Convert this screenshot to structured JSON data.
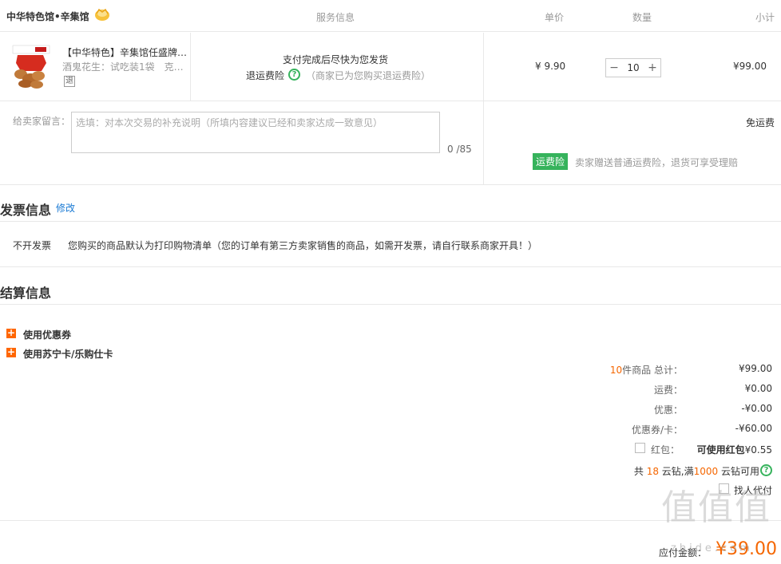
{
  "store": {
    "name": "中华特色馆•辛集馆"
  },
  "columns": {
    "service": "服务信息",
    "price": "单价",
    "quantity": "数量",
    "subtotal": "小计"
  },
  "item": {
    "title": "【中华特色】辛集馆任盛牌…",
    "spec": "酒鬼花生：试吃装1袋　克…",
    "return_tag": "退",
    "service_line1": "支付完成后尽快为您发货",
    "service_line2_label": "退运费险",
    "service_line2_note": "（商家已为您购买退运费险）",
    "price": "¥ 9.90",
    "qty": "10",
    "qty_minus": "−",
    "qty_plus": "+",
    "subtotal": "¥99.00"
  },
  "message": {
    "label": "给卖家留言：",
    "placeholder": "选填：对本次交易的补充说明（所填内容建议已经和卖家达成一致意见）",
    "count": "0 /85"
  },
  "shipping": {
    "free": "免运费",
    "insurance_tag": "运费险",
    "insurance_note": "卖家赠送普通运费险，退货可享受理赔"
  },
  "invoice": {
    "title": "发票信息",
    "edit": "修改",
    "type": "不开发票",
    "desc": "您购买的商品默认为打印购物清单（您的订单有第三方卖家销售的商品，如需开发票，请自行联系商家开具！）"
  },
  "settlement": {
    "title": "结算信息",
    "options": [
      "使用优惠券",
      "使用苏宁卡/乐购仕卡"
    ],
    "count_num": "10",
    "count_suffix": "件商品 总计：",
    "total": "¥99.00",
    "shipping_label": "运费：",
    "shipping_val": "¥0.00",
    "discount_label": "优惠：",
    "discount_val": "-¥0.00",
    "coupon_label": "优惠券/卡：",
    "coupon_val": "-¥60.00",
    "redpack_label": "红包：",
    "redpack_val_bold": "可使用红包",
    "redpack_val": "¥0.55",
    "diamond_pre": "共 ",
    "diamond_num": "18",
    "diamond_mid": " 云钻,满",
    "diamond_min": "1000",
    "diamond_suf": " 云钻可用",
    "proxy_pay": "找人代付",
    "payable_label": "应付金额：",
    "payable_val": "¥39.00"
  },
  "watermark": {
    "big": "值值值",
    "small": "zhide.com"
  }
}
